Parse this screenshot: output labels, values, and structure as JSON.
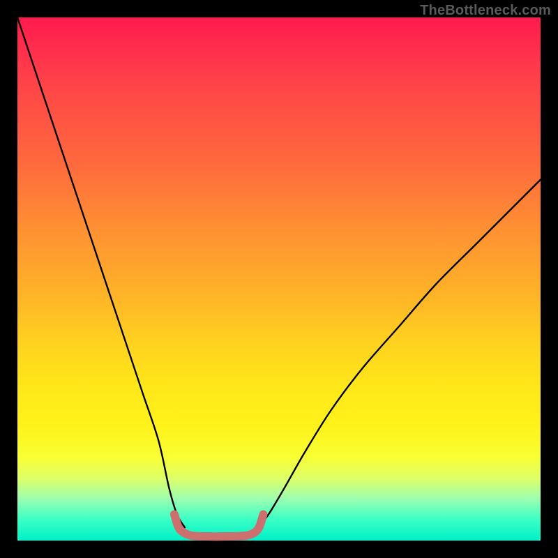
{
  "watermark": "TheBottleneck.com",
  "chart_data": {
    "type": "line",
    "title": "",
    "xlabel": "",
    "ylabel": "",
    "xlim": [
      0,
      100
    ],
    "ylim": [
      0,
      100
    ],
    "series": [
      {
        "name": "left-curve",
        "x": [
          0,
          3,
          6,
          9,
          12,
          15,
          18,
          21,
          24,
          27,
          29,
          30.5,
          32
        ],
        "values": [
          100,
          91,
          82,
          73,
          64,
          55,
          46,
          37,
          28,
          19,
          10,
          5,
          2.5
        ]
      },
      {
        "name": "right-curve",
        "x": [
          46,
          48,
          51,
          55,
          60,
          66,
          73,
          80,
          88,
          96,
          100
        ],
        "values": [
          2.5,
          5,
          10,
          17,
          25,
          33,
          41,
          49,
          57,
          65,
          69
        ]
      },
      {
        "name": "trough-marker",
        "x": [
          30,
          31,
          33,
          36,
          40,
          44,
          46,
          47
        ],
        "values": [
          5,
          2.2,
          1,
          0.8,
          0.8,
          1,
          2.2,
          5
        ]
      }
    ],
    "colors": {
      "curve": "#000000",
      "trough": "#cc6f6f"
    }
  }
}
